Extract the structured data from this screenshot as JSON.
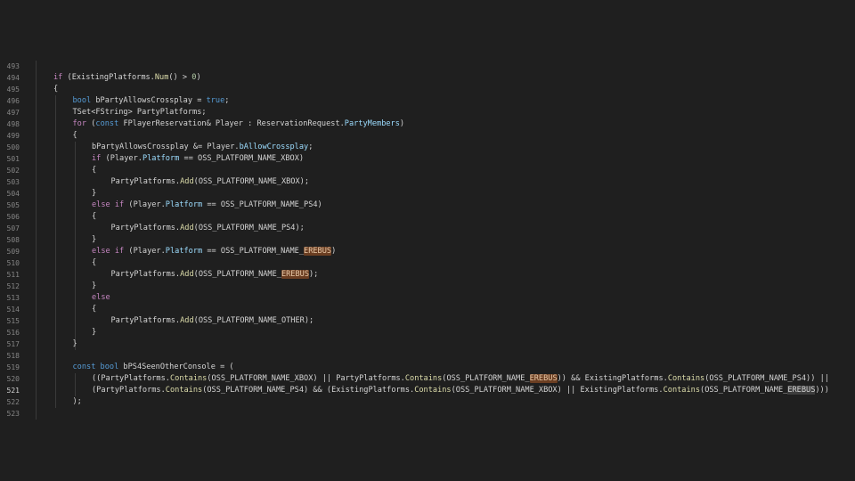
{
  "colors": {
    "background": "#1f1f1f",
    "keyword": "#569cd6",
    "control": "#c586c0",
    "function": "#dcdcaa",
    "type": "#4ec9b0",
    "variable": "#9cdcfe",
    "number": "#b5cea8",
    "highlight": "#6b3e22"
  },
  "active_line": "521",
  "lines": [
    {
      "n": "493",
      "indent": 0,
      "tokens": []
    },
    {
      "n": "494",
      "indent": 0,
      "tokens": [
        [
          "ctl",
          "if"
        ],
        [
          "plain",
          " (ExistingPlatforms."
        ],
        [
          "fn",
          "Num"
        ],
        [
          "plain",
          "() > "
        ],
        [
          "num",
          "0"
        ],
        [
          "plain",
          ")"
        ]
      ]
    },
    {
      "n": "495",
      "indent": 0,
      "tokens": [
        [
          "plain",
          "{"
        ]
      ]
    },
    {
      "n": "496",
      "indent": 1,
      "tokens": [
        [
          "kw",
          "bool"
        ],
        [
          "plain",
          " bPartyAllowsCrossplay = "
        ],
        [
          "kw",
          "true"
        ],
        [
          "plain",
          ";"
        ]
      ]
    },
    {
      "n": "497",
      "indent": 1,
      "tokens": [
        [
          "plain",
          "TSet<FString> PartyPlatforms;"
        ]
      ]
    },
    {
      "n": "498",
      "indent": 1,
      "tokens": [
        [
          "ctl",
          "for"
        ],
        [
          "plain",
          " ("
        ],
        [
          "kw",
          "const"
        ],
        [
          "plain",
          " FPlayerReservation& Player : ReservationRequest."
        ],
        [
          "var",
          "PartyMembers"
        ],
        [
          "plain",
          ")"
        ]
      ]
    },
    {
      "n": "499",
      "indent": 1,
      "tokens": [
        [
          "plain",
          "{"
        ]
      ]
    },
    {
      "n": "500",
      "indent": 2,
      "tokens": [
        [
          "plain",
          "bPartyAllowsCrossplay &= Player."
        ],
        [
          "var",
          "bAllowCrossplay"
        ],
        [
          "plain",
          ";"
        ]
      ]
    },
    {
      "n": "501",
      "indent": 2,
      "tokens": [
        [
          "ctl",
          "if"
        ],
        [
          "plain",
          " (Player."
        ],
        [
          "var",
          "Platform"
        ],
        [
          "plain",
          " == OSS_PLATFORM_NAME_XBOX)"
        ]
      ]
    },
    {
      "n": "502",
      "indent": 2,
      "tokens": [
        [
          "plain",
          "{"
        ]
      ]
    },
    {
      "n": "503",
      "indent": 3,
      "tokens": [
        [
          "plain",
          "PartyPlatforms."
        ],
        [
          "fn",
          "Add"
        ],
        [
          "plain",
          "(OSS_PLATFORM_NAME_XBOX);"
        ]
      ]
    },
    {
      "n": "504",
      "indent": 2,
      "tokens": [
        [
          "plain",
          "}"
        ]
      ]
    },
    {
      "n": "505",
      "indent": 2,
      "tokens": [
        [
          "ctl",
          "else if"
        ],
        [
          "plain",
          " (Player."
        ],
        [
          "var",
          "Platform"
        ],
        [
          "plain",
          " == OSS_PLATFORM_NAME_PS4)"
        ]
      ]
    },
    {
      "n": "506",
      "indent": 2,
      "tokens": [
        [
          "plain",
          "{"
        ]
      ]
    },
    {
      "n": "507",
      "indent": 3,
      "tokens": [
        [
          "plain",
          "PartyPlatforms."
        ],
        [
          "fn",
          "Add"
        ],
        [
          "plain",
          "(OSS_PLATFORM_NAME_PS4);"
        ]
      ]
    },
    {
      "n": "508",
      "indent": 2,
      "tokens": [
        [
          "plain",
          "}"
        ]
      ]
    },
    {
      "n": "509",
      "indent": 2,
      "tokens": [
        [
          "ctl",
          "else if"
        ],
        [
          "plain",
          " (Player."
        ],
        [
          "var",
          "Platform"
        ],
        [
          "plain",
          " == OSS_PLATFORM_NAME_"
        ],
        [
          "hl",
          "EREBUS"
        ],
        [
          "plain",
          ")"
        ]
      ]
    },
    {
      "n": "510",
      "indent": 2,
      "tokens": [
        [
          "plain",
          "{"
        ]
      ]
    },
    {
      "n": "511",
      "indent": 3,
      "tokens": [
        [
          "plain",
          "PartyPlatforms."
        ],
        [
          "fn",
          "Add"
        ],
        [
          "plain",
          "(OSS_PLATFORM_NAME_"
        ],
        [
          "hl",
          "EREBUS"
        ],
        [
          "plain",
          ");"
        ]
      ]
    },
    {
      "n": "512",
      "indent": 2,
      "tokens": [
        [
          "plain",
          "}"
        ]
      ]
    },
    {
      "n": "513",
      "indent": 2,
      "tokens": [
        [
          "ctl",
          "else"
        ]
      ]
    },
    {
      "n": "514",
      "indent": 2,
      "tokens": [
        [
          "plain",
          "{"
        ]
      ]
    },
    {
      "n": "515",
      "indent": 3,
      "tokens": [
        [
          "plain",
          "PartyPlatforms."
        ],
        [
          "fn",
          "Add"
        ],
        [
          "plain",
          "(OSS_PLATFORM_NAME_OTHER);"
        ]
      ]
    },
    {
      "n": "516",
      "indent": 2,
      "tokens": [
        [
          "plain",
          "}"
        ]
      ]
    },
    {
      "n": "517",
      "indent": 1,
      "tokens": [
        [
          "plain",
          "}"
        ]
      ]
    },
    {
      "n": "518",
      "indent": 0,
      "tokens": []
    },
    {
      "n": "519",
      "indent": 1,
      "tokens": [
        [
          "kw",
          "const bool"
        ],
        [
          "plain",
          " bPS4SeenOtherConsole = ("
        ]
      ]
    },
    {
      "n": "520",
      "indent": 2,
      "tokens": [
        [
          "plain",
          "((PartyPlatforms."
        ],
        [
          "fn",
          "Contains"
        ],
        [
          "plain",
          "(OSS_PLATFORM_NAME_XBOX) || PartyPlatforms."
        ],
        [
          "fn",
          "Contains"
        ],
        [
          "plain",
          "(OSS_PLATFORM_NAME_"
        ],
        [
          "hl",
          "EREBUS"
        ],
        [
          "plain",
          ")) && ExistingPlatforms."
        ],
        [
          "fn",
          "Contains"
        ],
        [
          "plain",
          "(OSS_PLATFORM_NAME_PS4)) ||"
        ]
      ]
    },
    {
      "n": "521",
      "indent": 2,
      "tokens": [
        [
          "plain",
          "(PartyPlatforms."
        ],
        [
          "fn",
          "Contains"
        ],
        [
          "plain",
          "(OSS_PLATFORM_NAME_PS4) && (ExistingPlatforms."
        ],
        [
          "fn",
          "Contains"
        ],
        [
          "plain",
          "(OSS_PLATFORM_NAME_XBOX) || ExistingPlatforms."
        ],
        [
          "fn",
          "Contains"
        ],
        [
          "plain",
          "(OSS_PLATFORM_NAME_"
        ],
        [
          "hl2",
          "EREBUS"
        ],
        [
          "plain",
          ")))"
        ]
      ]
    },
    {
      "n": "522",
      "indent": 1,
      "tokens": [
        [
          "plain",
          ");"
        ]
      ]
    },
    {
      "n": "523",
      "indent": 0,
      "tokens": []
    }
  ]
}
